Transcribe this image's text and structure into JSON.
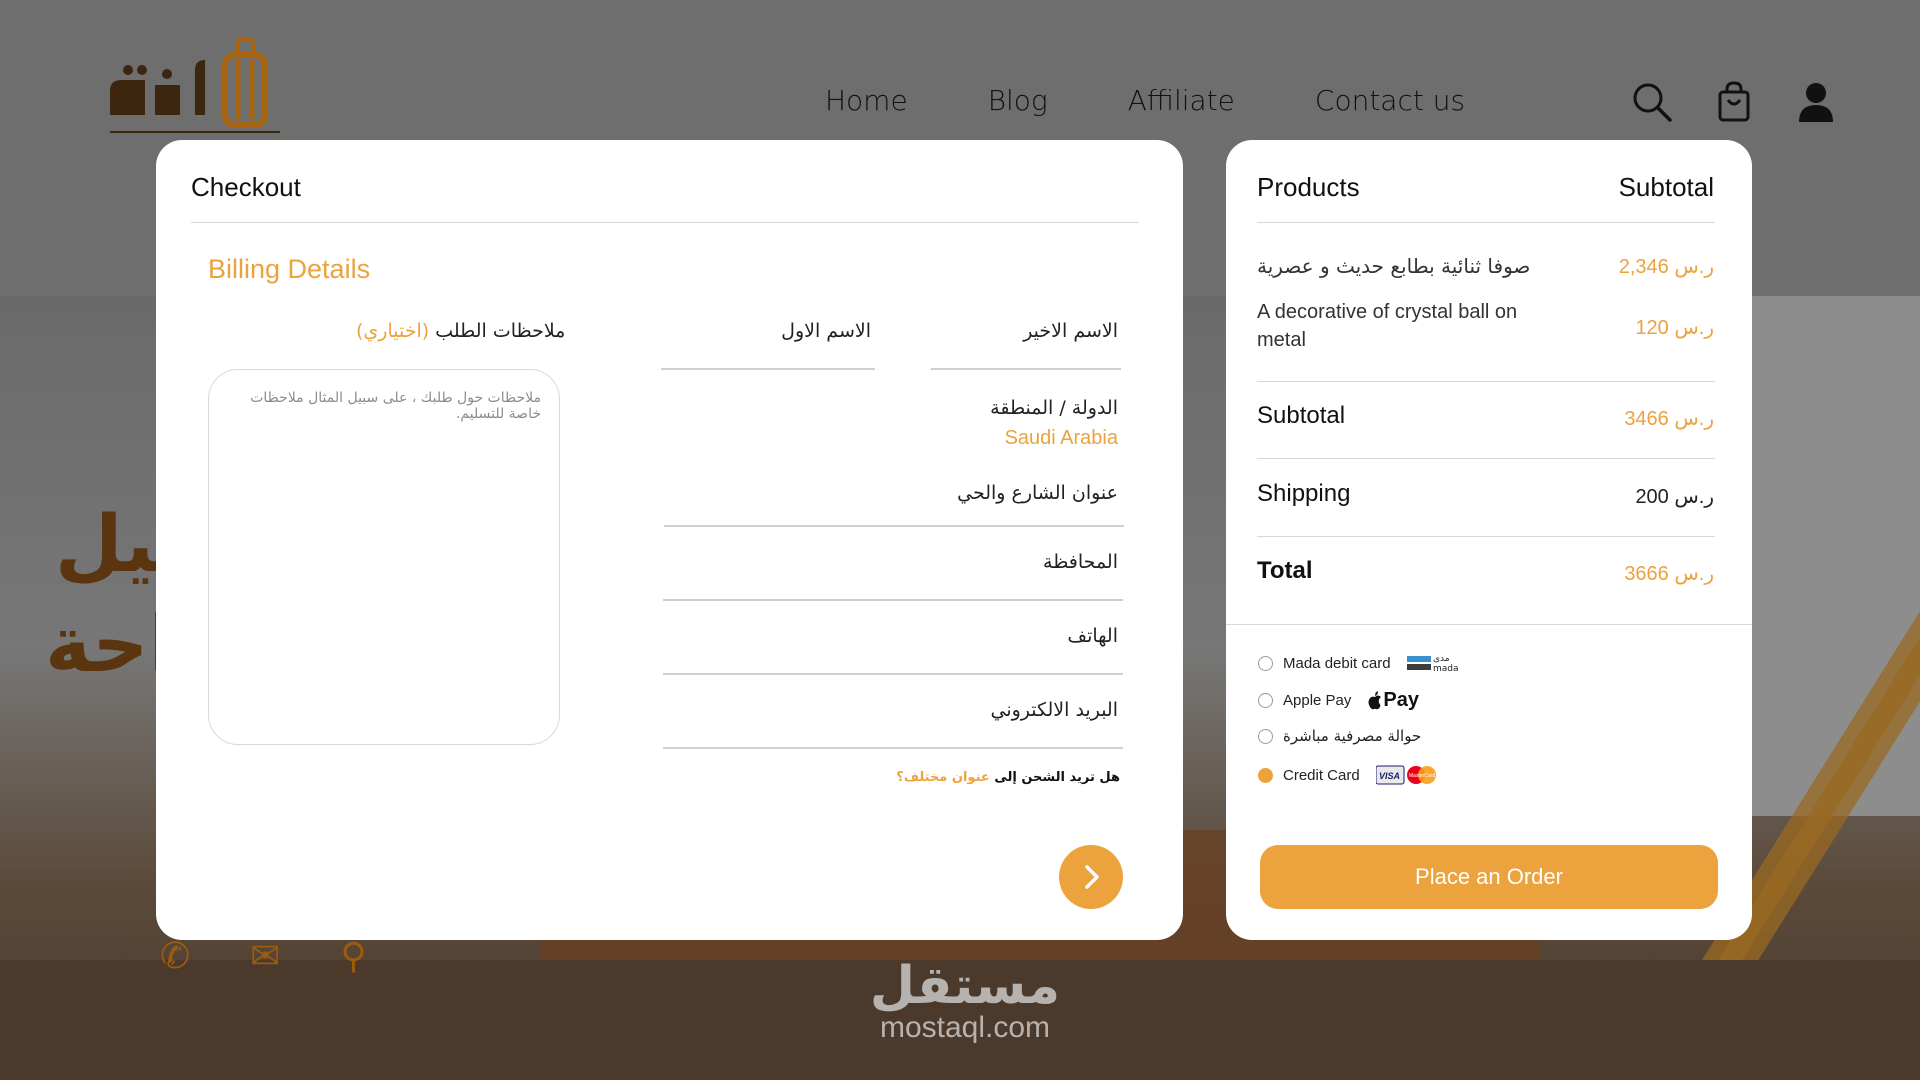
{
  "nav": {
    "items": [
      {
        "label": "Home"
      },
      {
        "label": "Blog"
      },
      {
        "label": "Affiliate"
      },
      {
        "label": "Contact us"
      }
    ]
  },
  "background": {
    "hero_line1": "ـصيل",
    "hero_line2": "راحة"
  },
  "checkout": {
    "title": "Checkout",
    "billing_title": "Billing Details",
    "last_name_label": "الاسم الاخير",
    "first_name_label": "الاسم الاول",
    "country_label": "الدولة / المنطقة",
    "country_value": "Saudi Arabia",
    "street_label": "عنوان الشارع والحي",
    "province_label": "المحافظة",
    "phone_label": "الهاتف",
    "email_label": "البريد الالكتروني",
    "notes_label": "ملاحظات الطلب",
    "notes_optional": "(اختياري)",
    "notes_placeholder": "ملاحظات حول طلبك ، على سبيل المثال ملاحظات خاصة للتسليم.",
    "ship_question": "هل تريد الشحن إلى",
    "ship_link": "عنوان مختلف؟"
  },
  "products": {
    "header_products": "Products",
    "header_subtotal": "Subtotal",
    "items": [
      {
        "name": "صوفا ثنائية بطابع حديث و عصرية",
        "price": "ر.س 2,346"
      },
      {
        "name": "A decorative of crystal ball on metal",
        "price": "ر.س 120"
      }
    ],
    "subtotal_label": "Subtotal",
    "subtotal_value": "ر.س 3466",
    "shipping_label": "Shipping",
    "shipping_value": "ر.س 200",
    "total_label": "Total",
    "total_value": "ر.س 3666",
    "payment_options": [
      {
        "label": "Mada debit card",
        "selected": false
      },
      {
        "label": "Apple Pay",
        "selected": false
      },
      {
        "label": "حوالة مصرفية مباشرة",
        "selected": false
      },
      {
        "label": "Credit Card",
        "selected": true
      }
    ],
    "mada_logo_ar": "مدى",
    "mada_logo_en": "mada",
    "applepay_logo": "Pay",
    "visa_logo": "VISA",
    "mastercard_logo": "MasterCard",
    "order_button": "Place an Order"
  },
  "watermark": {
    "arabic": "مستقل",
    "latin": "mostaql.com"
  },
  "colors": {
    "accent": "#eca23d",
    "overlay_bg": "#6b6b6b",
    "card_bg": "#ffffff"
  },
  "icons": [
    "search-icon",
    "shopping-bag-icon",
    "user-icon",
    "chevron-right-icon",
    "phone-icon",
    "mail-icon",
    "location-icon"
  ]
}
